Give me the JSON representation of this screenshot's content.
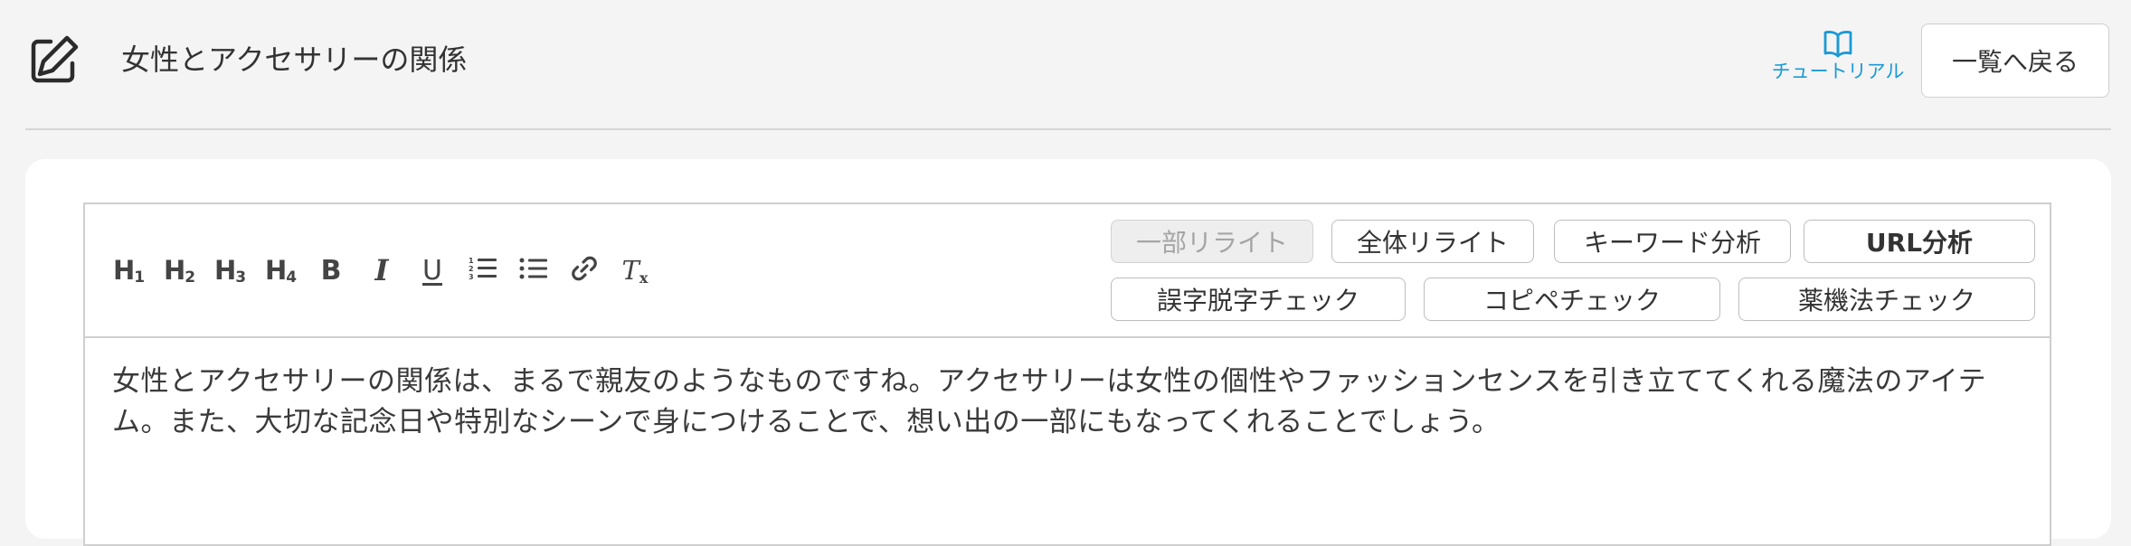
{
  "header": {
    "title": "女性とアクセサリーの関係",
    "tutorial_label": "チュートリアル",
    "back_label": "一覧へ戻る"
  },
  "toolbar": {
    "tools": [
      {
        "name": "h1",
        "label": "H",
        "sub": "1"
      },
      {
        "name": "h2",
        "label": "H",
        "sub": "2"
      },
      {
        "name": "h3",
        "label": "H",
        "sub": "3"
      },
      {
        "name": "h4",
        "label": "H",
        "sub": "4"
      },
      {
        "name": "bold",
        "label": "B"
      },
      {
        "name": "italic",
        "label": "I"
      },
      {
        "name": "underline",
        "label": "U"
      },
      {
        "name": "ordered-list"
      },
      {
        "name": "bullet-list"
      },
      {
        "name": "link"
      },
      {
        "name": "clear-format",
        "label": "T",
        "sub": "x"
      }
    ],
    "actions": {
      "partial_rewrite": "一部リライト",
      "full_rewrite": "全体リライト",
      "keyword_analysis": "キーワード分析",
      "url_analysis": "URL分析",
      "typo_check": "誤字脱字チェック",
      "copy_check": "コピペチェック",
      "pharma_check": "薬機法チェック"
    }
  },
  "editor": {
    "content": "女性とアクセサリーの関係は、まるで親友のようなものですね。アクセサリーは女性の個性やファッションセンスを引き立ててくれる魔法のアイテム。また、大切な記念日や特別なシーンで身につけることで、想い出の一部にもなってくれることでしょう。"
  },
  "colors": {
    "accent": "#1a9ad6",
    "background": "#f4f4f4",
    "card": "#ffffff",
    "border": "#cfcfcf",
    "disabled_bg": "#eeeeee",
    "disabled_text": "#a5a5a5"
  }
}
